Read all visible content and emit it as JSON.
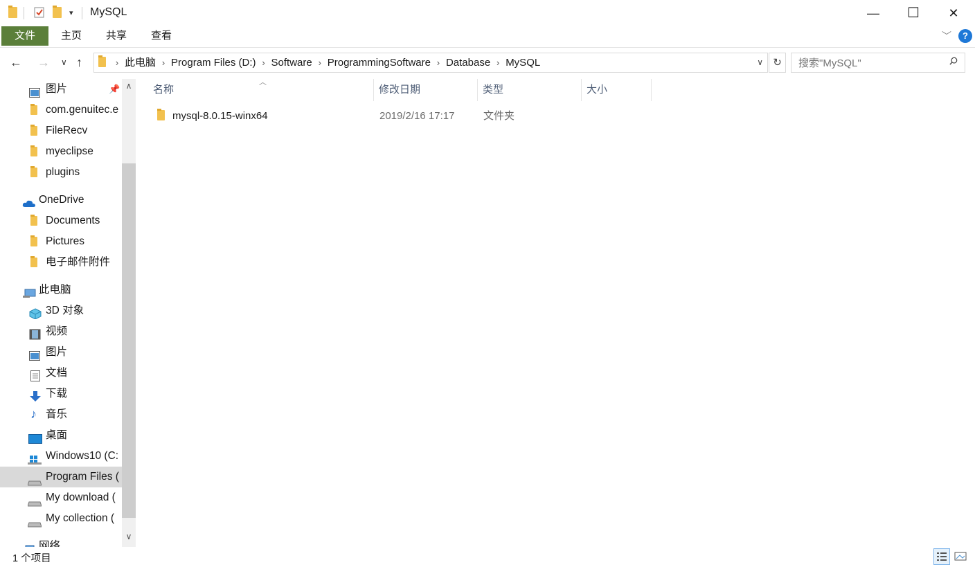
{
  "window": {
    "title": "MySQL",
    "minimize": "—",
    "maximize": "☐",
    "close": "✕"
  },
  "ribbon": {
    "tabs": [
      "文件",
      "主页",
      "共享",
      "查看"
    ]
  },
  "address": {
    "crumbs": [
      "此电脑",
      "Program Files (D:)",
      "Software",
      "ProgrammingSoftware",
      "Database",
      "MySQL"
    ],
    "search_placeholder": "搜索\"MySQL\""
  },
  "sidebar": {
    "items": [
      {
        "label": "图片",
        "icon": "pictures-icon",
        "pinned": true
      },
      {
        "label": "com.genuitec.e",
        "icon": "folder-icon"
      },
      {
        "label": "FileRecv",
        "icon": "folder-icon"
      },
      {
        "label": "myeclipse",
        "icon": "folder-icon"
      },
      {
        "label": "plugins",
        "icon": "folder-icon"
      },
      {
        "label": "OneDrive",
        "icon": "onedrive-icon"
      },
      {
        "label": "Documents",
        "icon": "folder-icon"
      },
      {
        "label": "Pictures",
        "icon": "folder-icon"
      },
      {
        "label": "电子邮件附件",
        "icon": "folder-icon"
      },
      {
        "label": "此电脑",
        "icon": "computer-icon"
      },
      {
        "label": "3D 对象",
        "icon": "3d-objects-icon"
      },
      {
        "label": "视频",
        "icon": "videos-icon"
      },
      {
        "label": "图片",
        "icon": "pictures-icon"
      },
      {
        "label": "文档",
        "icon": "documents-icon"
      },
      {
        "label": "下载",
        "icon": "downloads-icon"
      },
      {
        "label": "音乐",
        "icon": "music-icon"
      },
      {
        "label": "桌面",
        "icon": "desktop-icon"
      },
      {
        "label": "Windows10 (C:",
        "icon": "windows-drive-icon"
      },
      {
        "label": "Program Files (",
        "icon": "drive-icon",
        "selected": true
      },
      {
        "label": "My download (",
        "icon": "drive-icon"
      },
      {
        "label": "My collection (",
        "icon": "drive-icon"
      },
      {
        "label": "网络",
        "icon": "network-icon"
      }
    ]
  },
  "list": {
    "columns": [
      "名称",
      "修改日期",
      "类型",
      "大小"
    ],
    "rows": [
      {
        "name": "mysql-8.0.15-winx64",
        "modified": "2019/2/16 17:17",
        "type": "文件夹",
        "size": ""
      }
    ]
  },
  "status": {
    "text": "1 个项目"
  },
  "colors": {
    "file_tab": "#5b7f3a",
    "folder": "#f2c14e",
    "selected": "#d9d9d9",
    "help": "#1e78d7"
  }
}
